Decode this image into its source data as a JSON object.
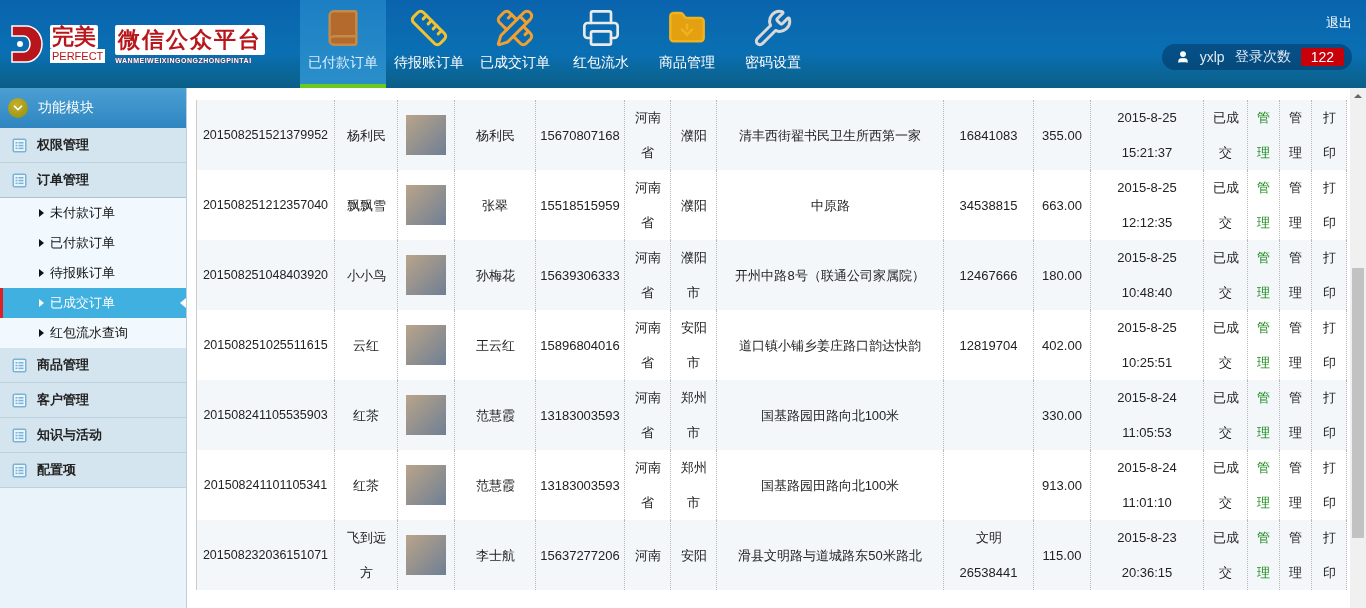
{
  "logo": {
    "brand_cn": "完美",
    "brand_en": "PERFECT",
    "title": "微信公众平台",
    "subtitle": "WANMEIWEIXINGONGZHONGPINTAI"
  },
  "nav": [
    {
      "label": "已付款订单",
      "kind": "book",
      "selected": true
    },
    {
      "label": "待报账订单",
      "kind": "ruler",
      "selected": false
    },
    {
      "label": "已成交订单",
      "kind": "pencil",
      "selected": false
    },
    {
      "label": "红包流水",
      "kind": "printer",
      "selected": false
    },
    {
      "label": "商品管理",
      "kind": "folder",
      "selected": false
    },
    {
      "label": "密码设置",
      "kind": "tools",
      "selected": false
    }
  ],
  "logout": "退出",
  "user": {
    "name": "yxlp",
    "login_label": "登录次数",
    "login_count": "122"
  },
  "sidebar": {
    "title": "功能模块",
    "groups": [
      {
        "label": "权限管理",
        "expanded": false
      },
      {
        "label": "订单管理",
        "expanded": true,
        "children": [
          {
            "label": "未付款订单",
            "selected": false
          },
          {
            "label": "已付款订单",
            "selected": false
          },
          {
            "label": "待报账订单",
            "selected": false
          },
          {
            "label": "已成交订单",
            "selected": true
          },
          {
            "label": "红包流水查询",
            "selected": false
          }
        ]
      },
      {
        "label": "商品管理",
        "expanded": false
      },
      {
        "label": "客户管理",
        "expanded": false
      },
      {
        "label": "知识与活动",
        "expanded": false
      },
      {
        "label": "配置项",
        "expanded": false
      }
    ]
  },
  "table": {
    "rows": [
      {
        "order_no": "201508251521379952",
        "nickname": "杨利民",
        "name": "杨利民",
        "phone": "15670807168",
        "province": "河南省",
        "city": "濮阳",
        "address": "清丰西街翟书民卫生所西第一家",
        "column_9": "16841083",
        "amount": "355.00",
        "time": "2015-8-25 15:21:37",
        "status": "已成交",
        "manage_1": "管理",
        "manage_2": "管理",
        "print": "打印"
      },
      {
        "order_no": "201508251212357040",
        "nickname": "飘飘雪",
        "name": "张翠",
        "phone": "15518515959",
        "province": "河南省",
        "city": "濮阳",
        "address": "中原路",
        "column_9": "34538815",
        "amount": "663.00",
        "time": "2015-8-25 12:12:35",
        "status": "已成交",
        "manage_1": "管理",
        "manage_2": "管理",
        "print": "打印"
      },
      {
        "order_no": "201508251048403920",
        "nickname": "小小鸟",
        "name": "孙梅花",
        "phone": "15639306333",
        "province": "河南省",
        "city": "濮阳市",
        "address": "开州中路8号（联通公司家属院）",
        "column_9": "12467666",
        "amount": "180.00",
        "time": "2015-8-25 10:48:40",
        "status": "已成交",
        "manage_1": "管理",
        "manage_2": "管理",
        "print": "打印"
      },
      {
        "order_no": "201508251025511615",
        "nickname": "云红",
        "name": "王云红",
        "phone": "15896804016",
        "province": "河南省",
        "city": "安阳市",
        "address": "道口镇小铺乡姜庄路口韵达快韵",
        "column_9": "12819704",
        "amount": "402.00",
        "time": "2015-8-25 10:25:51",
        "status": "已成交",
        "manage_1": "管理",
        "manage_2": "管理",
        "print": "打印"
      },
      {
        "order_no": "201508241105535903",
        "nickname": "红茶",
        "name": "范慧霞",
        "phone": "13183003593",
        "province": "河南省",
        "city": "郑州市",
        "address": "国基路园田路向北100米",
        "amount": "330.00",
        "time": "2015-8-24 11:05:53",
        "status": "已成交",
        "manage_1": "管理",
        "manage_2": "管理",
        "print": "打印"
      },
      {
        "order_no": "201508241101105341",
        "nickname": "红茶",
        "name": "范慧霞",
        "phone": "13183003593",
        "province": "河南省",
        "city": "郑州市",
        "address": "国基路园田路向北100米",
        "amount": "913.00",
        "time": "2015-8-24 11:01:10",
        "status": "已成交",
        "manage_1": "管理",
        "manage_2": "管理",
        "print": "打印"
      },
      {
        "order_no": "201508232036151071",
        "nickname": "飞到远方",
        "name": "李士航",
        "phone": "15637277206",
        "province": "河南",
        "city": "安阳",
        "address": "滑县文明路与道城路东50米路北",
        "column_9": "文明 26538441",
        "amount": "115.00",
        "time": "2015-8-23 20:36:15",
        "status": "已成交",
        "manage_1": "管理",
        "manage_2": "管理",
        "print": "打印"
      }
    ]
  }
}
